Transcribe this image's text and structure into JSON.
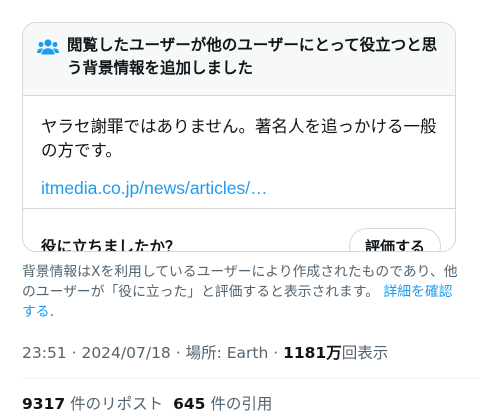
{
  "note": {
    "icon": "people-icon",
    "title": "閲覧したユーザーが他のユーザーにとって役立つと思う背景情報を追加しました",
    "body": "ヤラセ謝罪ではありません。著名人を追っかける一般の方です。",
    "link": "itmedia.co.jp/news/articles/…",
    "helpful_question": "役に立ちましたか？",
    "rate_button": "評価する"
  },
  "footnote": {
    "text": "背景情報はXを利用しているユーザーにより作成されたものであり、他のユーザーが「役に立った」と評価すると表示されます。",
    "link": "詳細を確認する",
    "period": "."
  },
  "meta": {
    "time": "23:51",
    "date": "2024/07/18",
    "location_label": "場所: Earth",
    "views_count": "1181万",
    "views_label": "回表示",
    "separator": " · "
  },
  "stats": {
    "reposts_count": "9317",
    "reposts_label": "件のリポスト",
    "quotes_count": "645",
    "quotes_label": "件の引用"
  },
  "colors": {
    "accent": "#1d9bf0",
    "text": "#0f1419",
    "secondary_text": "#536471",
    "border": "#cfd9de"
  }
}
